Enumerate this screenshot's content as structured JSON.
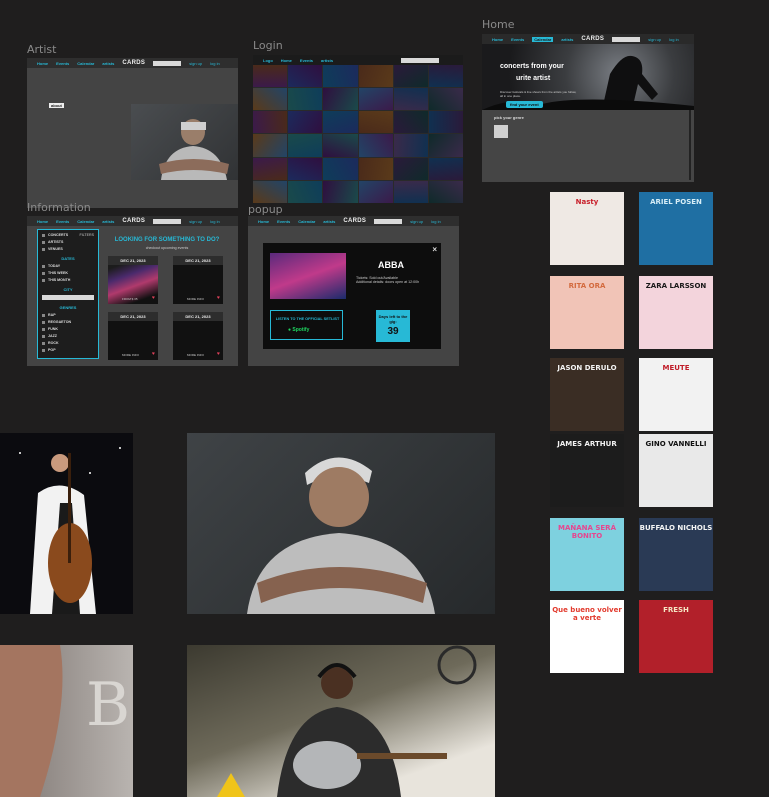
{
  "nav": {
    "home": "Home",
    "events": "Events",
    "calendar": "Calendar",
    "artists": "artists",
    "logo": "CARDS",
    "signup": "sign up",
    "login": "log in",
    "login_logo": "Logo"
  },
  "frames": {
    "artist": "Artist",
    "login": "Login",
    "home": "Home",
    "information": "Information",
    "popup": "popup"
  },
  "artist": {
    "about": "about"
  },
  "home": {
    "hero_line1": "concerts from your",
    "hero_line2": "urite artist",
    "blurb": "Discover festivals & live shows from the artists you follow, all in one place.",
    "find_button": "find your event",
    "pick_genre": "pick your genre"
  },
  "information": {
    "filters": "FILTERS",
    "title": "LOOKING FOR SOMETHING TO DO?",
    "subtitle": "checkout upcoming events",
    "sidebar_top": [
      "CONCERTS",
      "ARTISTS",
      "VENUES"
    ],
    "dates_head": "DATES",
    "dates": [
      "TODAY",
      "THIS WEEK",
      "THIS MONTH"
    ],
    "city_head": "CITY",
    "genres_head": "GENRES",
    "genres": [
      "RAP",
      "REGGAETON",
      "FUNK",
      "JAZZ",
      "ROCK",
      "POP"
    ],
    "cards": [
      {
        "date": "DEC 21, 2023",
        "foot": "FROM $ 35"
      },
      {
        "date": "DEC 21, 2023",
        "foot": "MORE INFO"
      },
      {
        "date": "DEC 21, 2023",
        "foot": "MORE INFO"
      },
      {
        "date": "DEC 21, 2023",
        "foot": "MORE INFO"
      }
    ]
  },
  "popup": {
    "name": "ABBA",
    "info_line1": "Tickets: Sold out/Available",
    "info_line2": "Additional details: doors open at 12:00h",
    "setlist": "LISTEN TO THE OFFICIAL SETLIST",
    "spotify": "Spotify",
    "days_label": "Days left to the gig:",
    "days": "39",
    "close": "×"
  },
  "posters": [
    {
      "title": "Nasty",
      "bg": "#efe9e4",
      "fg": "#c8202b"
    },
    {
      "title": "ARIEL POSEN",
      "bg": "#1f6fa3",
      "fg": "#d7eef7"
    },
    {
      "title": "RITA ORA",
      "bg": "#f1c4b7",
      "fg": "#d36a3e"
    },
    {
      "title": "ZARA LARSSON",
      "bg": "#f3d4dc",
      "fg": "#1a1a1a"
    },
    {
      "title": "JASON DERULO",
      "bg": "#3a2d24",
      "fg": "#f3f3f3"
    },
    {
      "title": "MEUTE",
      "bg": "#f2f2f2",
      "fg": "#c01c28"
    },
    {
      "title": "JAMES ARTHUR",
      "bg": "#1c1c1c",
      "fg": "#f2f2f2"
    },
    {
      "title": "GINO VANNELLI",
      "bg": "#e9e9e9",
      "fg": "#111111"
    },
    {
      "title": "MAÑANA SERÁ BONITO",
      "bg": "#7ed1df",
      "fg": "#e6468f"
    },
    {
      "title": "BUFFALO NICHOLS",
      "bg": "#2a3a55",
      "fg": "#f4f4f4"
    },
    {
      "title": "Que bueno volver a verte",
      "bg": "#ffffff",
      "fg": "#e23b2e"
    },
    {
      "title": "FRESH",
      "bg": "#b2202a",
      "fg": "#f5e6c4"
    }
  ],
  "colors": {
    "accent": "#27b9d6",
    "background": "#1f1e1e",
    "frame": "#444444"
  }
}
